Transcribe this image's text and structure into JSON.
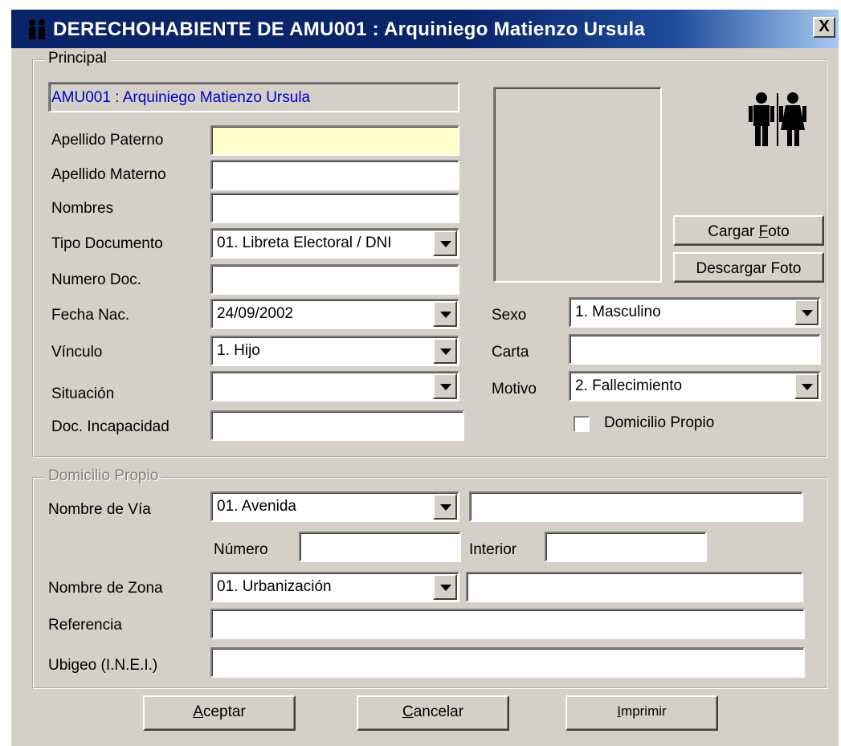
{
  "window": {
    "title": "DERECHOHABIENTE DE AMU001 : Arquiniego Matienzo Ursula",
    "close": "X"
  },
  "principal": {
    "legend": "Principal",
    "header_value": "AMU001 : Arquiniego Matienzo Ursula",
    "labels": {
      "apellido_paterno": "Apellido Paterno",
      "apellido_materno": "Apellido Materno",
      "nombres": "Nombres",
      "tipo_documento": "Tipo Documento",
      "numero_doc": "Numero Doc.",
      "fecha_nac": "Fecha Nac.",
      "vinculo": "Vínculo",
      "situacion": "Situación",
      "doc_incapacidad": "Doc. Incapacidad",
      "sexo": "Sexo",
      "carta": "Carta",
      "motivo": "Motivo"
    },
    "values": {
      "apellido_paterno": "",
      "apellido_materno": "",
      "nombres": "",
      "tipo_documento": "01. Libreta Electoral / DNI",
      "numero_doc": "",
      "fecha_nac": "24/09/2002",
      "vinculo": "1. Hijo",
      "situacion": "",
      "doc_incapacidad": "",
      "sexo": "1. Masculino",
      "carta": "",
      "motivo": "2. Fallecimiento"
    },
    "buttons": {
      "cargar_foto_pre": "Cargar ",
      "cargar_foto_key": "F",
      "cargar_foto_post": "oto",
      "descargar_foto": "Descargar Foto"
    },
    "checkbox_domicilio": "Domicilio Propio",
    "domicilio_checked": false
  },
  "domicilio": {
    "legend": "Domicilio Propio",
    "labels": {
      "nombre_via": "Nombre de Vía",
      "numero": "Número",
      "interior": "Interior",
      "nombre_zona": "Nombre de Zona",
      "referencia": "Referencia",
      "ubigeo": "Ubigeo (I.N.E.I.)"
    },
    "values": {
      "tipo_via": "01. Avenida",
      "nombre_via": "",
      "numero": "",
      "interior": "",
      "tipo_zona": "01. Urbanización",
      "nombre_zona": "",
      "referencia": "",
      "ubigeo": ""
    }
  },
  "footer": {
    "aceptar_key": "A",
    "aceptar_rest": "ceptar",
    "cancelar_key": "C",
    "cancelar_rest": "ancelar",
    "imprimir_key": "I",
    "imprimir_rest": "mprimir"
  },
  "colors": {
    "titlebar": "#0a246a",
    "face": "#d4d0c8",
    "header_text": "#0000cc",
    "focus_field": "#ffffcc"
  }
}
